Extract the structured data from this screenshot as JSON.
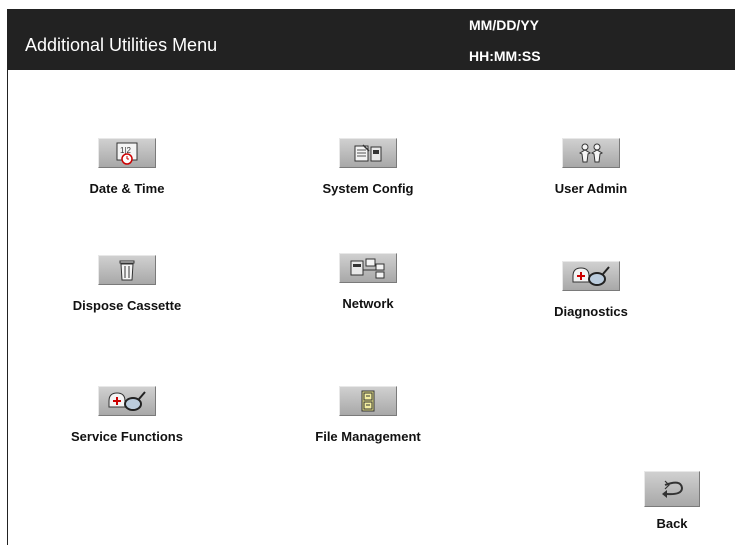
{
  "header": {
    "title": "Additional Utilities Menu",
    "date": "MM/DD/YY",
    "time": "HH:MM:SS"
  },
  "menu": {
    "date_time": {
      "label": "Date & Time",
      "icon": "calendar-clock-icon"
    },
    "system_config": {
      "label": "System Config",
      "icon": "config-icon"
    },
    "user_admin": {
      "label": "User Admin",
      "icon": "users-icon"
    },
    "dispose_cassette": {
      "label": "Dispose Cassette",
      "icon": "trash-icon"
    },
    "network": {
      "label": "Network",
      "icon": "network-icon"
    },
    "diagnostics": {
      "label": "Diagnostics",
      "icon": "stethoscope-icon"
    },
    "service_functions": {
      "label": "Service Functions",
      "icon": "stethoscope-icon"
    },
    "file_management": {
      "label": "File Management",
      "icon": "file-cabinet-icon"
    },
    "back": {
      "label": "Back",
      "icon": "back-arrow-icon"
    }
  },
  "colors": {
    "header_bg": "#222222",
    "button_bg": "#bdbdbd"
  }
}
